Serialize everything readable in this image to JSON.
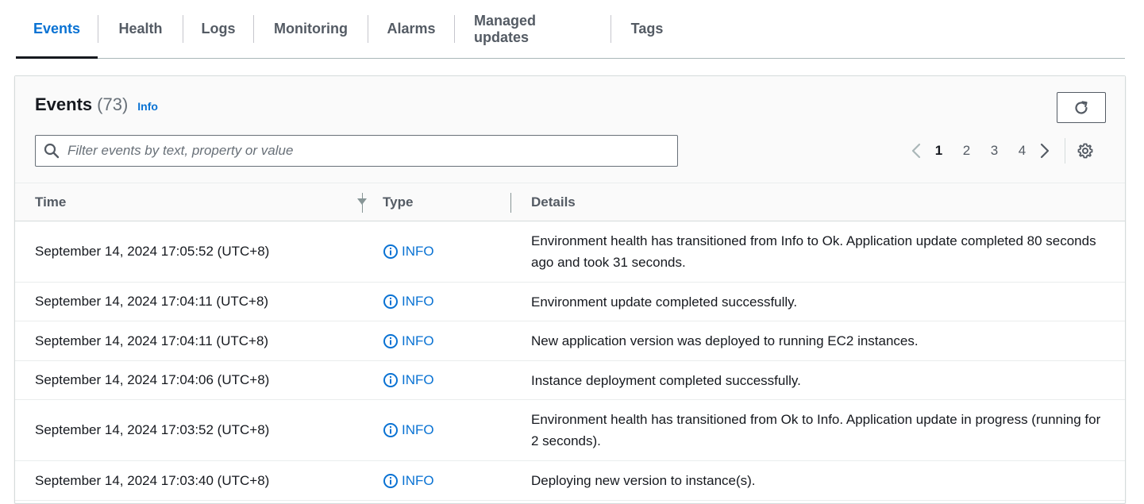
{
  "tabs": [
    {
      "label": "Events",
      "active": true
    },
    {
      "label": "Health",
      "active": false
    },
    {
      "label": "Logs",
      "active": false
    },
    {
      "label": "Monitoring",
      "active": false
    },
    {
      "label": "Alarms",
      "active": false
    },
    {
      "label": "Managed updates",
      "active": false
    },
    {
      "label": "Tags",
      "active": false
    }
  ],
  "panel": {
    "title": "Events",
    "count": "(73)",
    "info_link": "Info",
    "search_placeholder": "Filter events by text, property or value"
  },
  "pagination": {
    "pages": [
      "1",
      "2",
      "3",
      "4"
    ],
    "current": "1"
  },
  "table": {
    "columns": [
      "Time",
      "Type",
      "Details"
    ],
    "rows": [
      {
        "time": "September 14, 2024 17:05:52 (UTC+8)",
        "type": "INFO",
        "details": "Environment health has transitioned from Info to Ok. Application update completed 80 seconds ago and took 31 seconds."
      },
      {
        "time": "September 14, 2024 17:04:11 (UTC+8)",
        "type": "INFO",
        "details": "Environment update completed successfully."
      },
      {
        "time": "September 14, 2024 17:04:11 (UTC+8)",
        "type": "INFO",
        "details": "New application version was deployed to running EC2 instances."
      },
      {
        "time": "September 14, 2024 17:04:06 (UTC+8)",
        "type": "INFO",
        "details": "Instance deployment completed successfully."
      },
      {
        "time": "September 14, 2024 17:03:52 (UTC+8)",
        "type": "INFO",
        "details": "Environment health has transitioned from Ok to Info. Application update in progress (running for 2 seconds)."
      },
      {
        "time": "September 14, 2024 17:03:40 (UTC+8)",
        "type": "INFO",
        "details": "Deploying new version to instance(s)."
      }
    ]
  },
  "colors": {
    "accent": "#0972d3",
    "text": "#16191f",
    "muted": "#545b64"
  },
  "icons": {
    "refresh": "refresh-icon",
    "search": "search-icon",
    "prev": "chevron-left-icon",
    "next": "chevron-right-icon",
    "settings": "gear-icon",
    "sort": "caret-down-icon",
    "info": "info-circle-icon"
  }
}
